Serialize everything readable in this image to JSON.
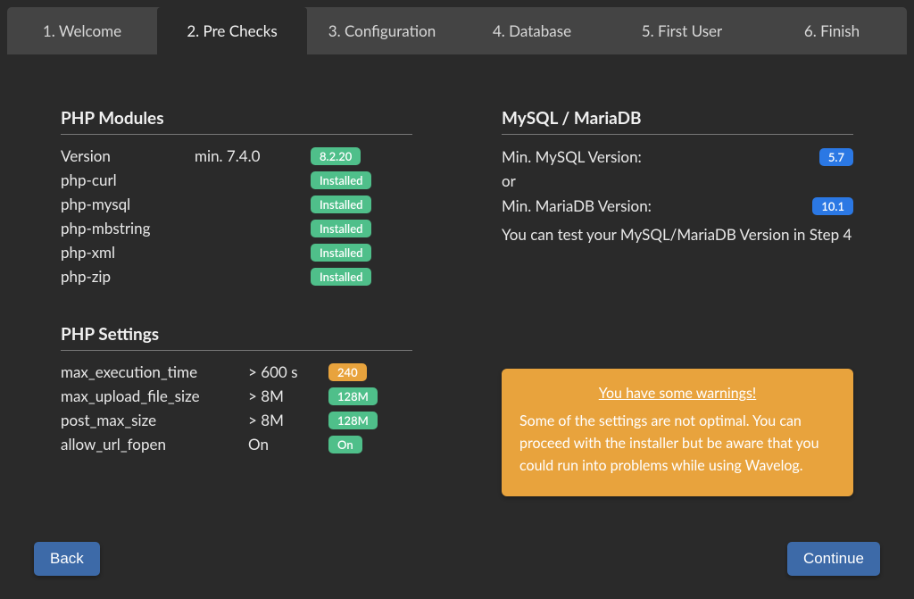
{
  "tabs": [
    {
      "label": "1. Welcome",
      "active": false
    },
    {
      "label": "2. Pre Checks",
      "active": true
    },
    {
      "label": "3. Configuration",
      "active": false
    },
    {
      "label": "4. Database",
      "active": false
    },
    {
      "label": "5. First User",
      "active": false
    },
    {
      "label": "6. Finish",
      "active": false
    }
  ],
  "sections": {
    "php_modules": {
      "title": "PHP Modules",
      "rows": [
        {
          "name": "Version",
          "req": "min. 7.4.0",
          "badge": "8.2.20",
          "badge_color": "green"
        },
        {
          "name": "php-curl",
          "req": "",
          "badge": "Installed",
          "badge_color": "green"
        },
        {
          "name": "php-mysql",
          "req": "",
          "badge": "Installed",
          "badge_color": "green"
        },
        {
          "name": "php-mbstring",
          "req": "",
          "badge": "Installed",
          "badge_color": "green"
        },
        {
          "name": "php-xml",
          "req": "",
          "badge": "Installed",
          "badge_color": "green"
        },
        {
          "name": "php-zip",
          "req": "",
          "badge": "Installed",
          "badge_color": "green"
        }
      ]
    },
    "php_settings": {
      "title": "PHP Settings",
      "rows": [
        {
          "name": "max_execution_time",
          "req": "> 600 s",
          "badge": "240",
          "badge_color": "orange"
        },
        {
          "name": "max_upload_file_size",
          "req": "> 8M",
          "badge": "128M",
          "badge_color": "green"
        },
        {
          "name": "post_max_size",
          "req": "> 8M",
          "badge": "128M",
          "badge_color": "green"
        },
        {
          "name": "allow_url_fopen",
          "req": "On",
          "badge": "On",
          "badge_color": "green"
        }
      ]
    },
    "db": {
      "title": "MySQL / MariaDB",
      "rows": [
        {
          "name": "Min. MySQL Version:",
          "badge": "5.7",
          "badge_color": "blue"
        },
        {
          "name": "or",
          "badge": "",
          "badge_color": ""
        },
        {
          "name": "Min. MariaDB Version:",
          "badge": "10.1",
          "badge_color": "blue"
        }
      ],
      "note": "You can test your MySQL/MariaDB Version in Step 4"
    }
  },
  "alert": {
    "title": "You have some warnings!",
    "body": "Some of the settings are not optimal. You can proceed with the installer but be aware that you could run into problems while using Wavelog."
  },
  "buttons": {
    "back": "Back",
    "continue": "Continue"
  }
}
